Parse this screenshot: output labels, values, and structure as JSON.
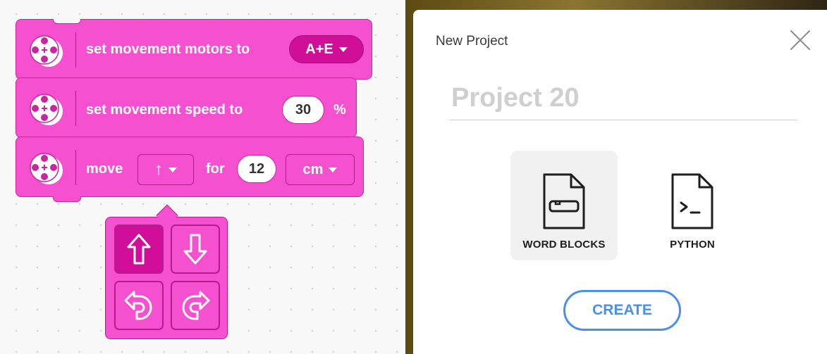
{
  "blocks": [
    {
      "text": "set movement motors to",
      "dropdown_value": "A+E"
    },
    {
      "text": "set movement speed to",
      "input_value": "30",
      "unit": "%"
    },
    {
      "text_move": "move",
      "text_for": "for",
      "direction_value": "↑",
      "distance_value": "12",
      "unit_value": "cm"
    }
  ],
  "direction_picker": {
    "options": [
      "up-arrow",
      "down-arrow",
      "rotate-counterclockwise",
      "rotate-clockwise"
    ],
    "selected": "up-arrow"
  },
  "dialog": {
    "title": "New Project",
    "project_name_placeholder": "Project 20",
    "project_types": [
      {
        "label": "WORD BLOCKS",
        "icon": "word-blocks-icon",
        "selected": true
      },
      {
        "label": "PYTHON",
        "icon": "python-icon",
        "selected": false
      }
    ],
    "create_label": "CREATE"
  },
  "colors": {
    "block": "#f550cf",
    "block_dark": "#cf0f98",
    "accent_blue": "#4b8fe8"
  }
}
